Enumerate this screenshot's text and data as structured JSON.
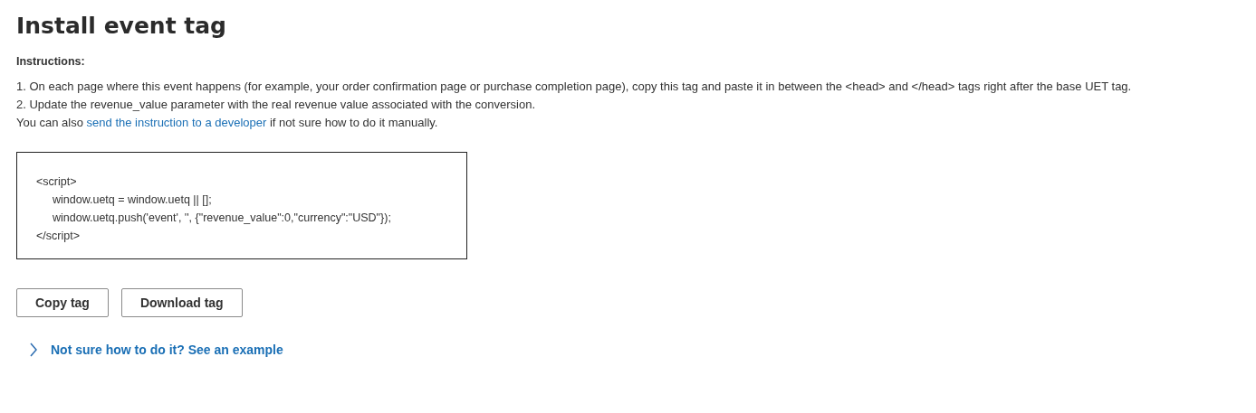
{
  "title": "Install event tag",
  "instructions": {
    "heading": "Instructions:",
    "steps": [
      "1. On each page where this event happens (for example, your order confirmation page or purchase completion page), copy this tag and paste it in between the <head> and </head> tags right after the base UET tag.",
      "2. Update the revenue_value parameter with the real revenue value associated with the conversion."
    ],
    "note": {
      "before": "You can also",
      "link": "send the instruction to a developer",
      "after": "if not sure how to do it manually."
    }
  },
  "code": [
    {
      "text": "<script>",
      "indented": false
    },
    {
      "text": "window.uetq = window.uetq || [];",
      "indented": true
    },
    {
      "text": "window.uetq.push('event', '', {\"revenue_value\":0,\"currency\":\"USD\"});",
      "indented": true
    },
    {
      "text": "</script>",
      "indented": false
    }
  ],
  "buttons": [
    "Copy tag",
    "Download tag"
  ],
  "example": {
    "label": "Not sure how to do it? See an example",
    "expanded": false
  }
}
